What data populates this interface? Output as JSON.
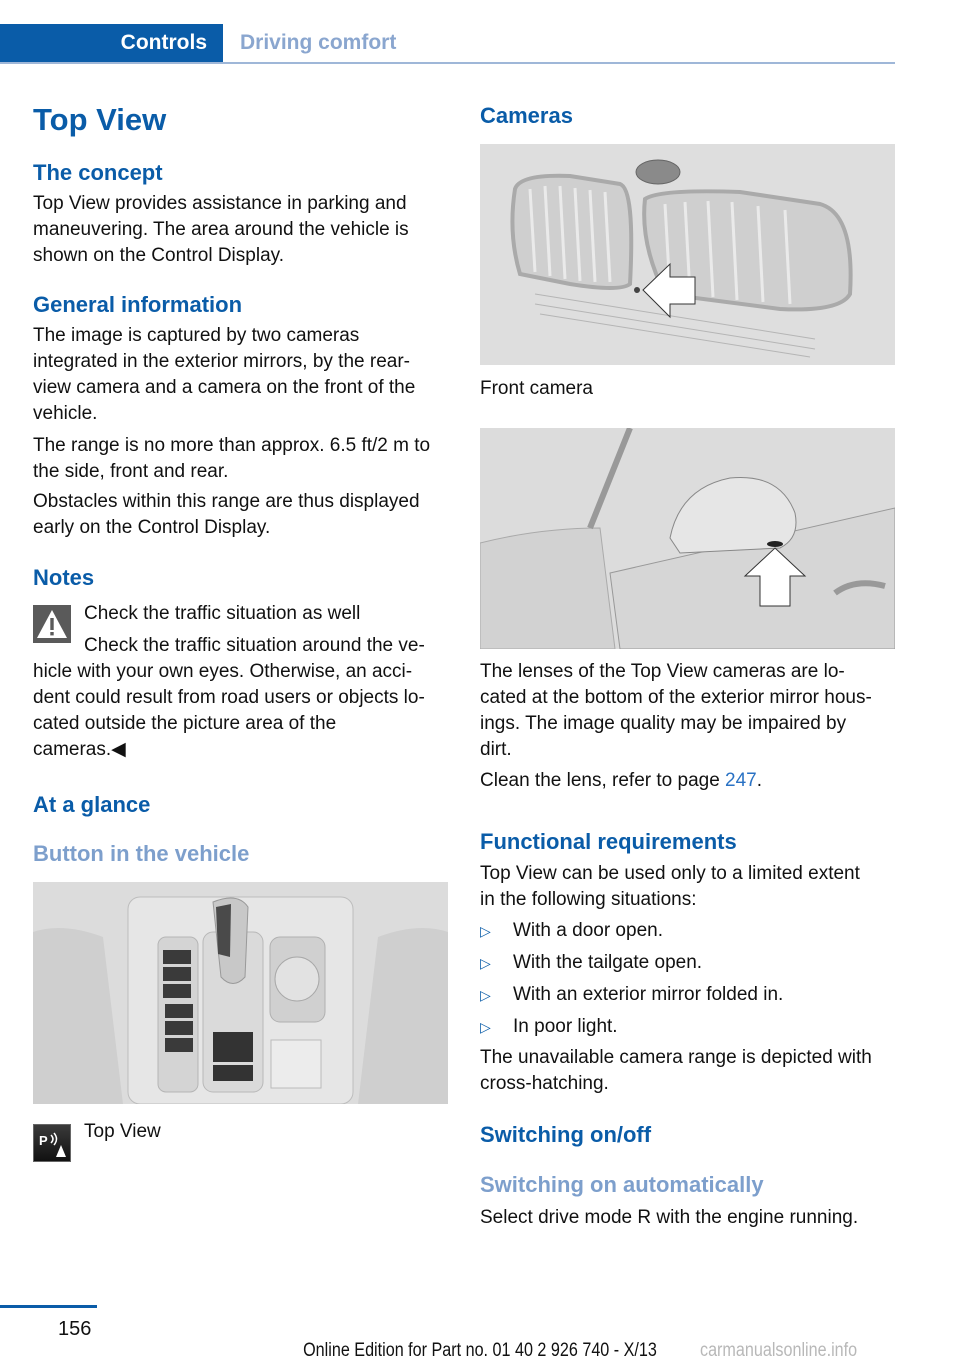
{
  "header": {
    "active_tab": "Controls",
    "section_tab": "Driving comfort"
  },
  "left": {
    "title": "Top View",
    "concept": {
      "heading": "The concept",
      "text": [
        "Top View provides assistance in parking and",
        "maneuvering. The area around the vehicle is",
        "shown on the Control Display."
      ]
    },
    "general": {
      "heading": "General information",
      "p1": [
        "The image is captured by two cameras",
        "integrated in the exterior mirrors, by the rear-",
        "view camera and a camera on the front of the",
        "vehicle."
      ],
      "p2": [
        "The range is no more than approx. 6.5 ft/2 m to",
        "the side, front and rear."
      ],
      "p3": [
        "Obstacles within this range are thus displayed",
        "early on the Control Display."
      ]
    },
    "notes": {
      "heading": "Notes",
      "warning_title": "Check the traffic situation as well",
      "warning_text": [
        "Check the traffic situation around the ve-",
        "hicle with your own eyes. Otherwise, an acci-",
        "dent could result from road users or objects lo-",
        "cated outside the picture area of the",
        "cameras.◀"
      ]
    },
    "glance": {
      "heading": "At a glance",
      "subheading": "Button in the vehicle",
      "image_alt": "Center console with gear selector and buttons",
      "button_label": "Top View",
      "button_icon": "parking-top-view-icon"
    }
  },
  "right": {
    "cameras": {
      "heading": "Cameras",
      "image1_alt": "Front grille with camera arrow",
      "caption1": "Front camera",
      "image2_alt": "Exterior mirror with camera arrow",
      "text": [
        "The lenses of the Top View cameras are lo-",
        "cated at the bottom of the exterior mirror hous-",
        "ings. The image quality may be impaired by",
        "dirt."
      ],
      "clean_prefix": "Clean the lens, refer to page ",
      "clean_page": "247",
      "clean_suffix": "."
    },
    "requirements": {
      "heading": "Functional requirements",
      "intro": [
        "Top View can be used only to a limited extent",
        "in the following situations:"
      ],
      "items": [
        "With a door open.",
        "With the tailgate open.",
        "With an exterior mirror folded in.",
        "In poor light."
      ],
      "after": [
        "The unavailable camera range is depicted with",
        "cross-hatching."
      ]
    },
    "switching": {
      "heading": "Switching on/off",
      "subheading": "Switching on automatically",
      "text": "Select drive mode R with the engine running."
    }
  },
  "footer": {
    "page_number": "156",
    "edition": "Online Edition for Part no. 01 40 2 926 740 - X/13",
    "watermark": "carmanualsonline.info"
  }
}
